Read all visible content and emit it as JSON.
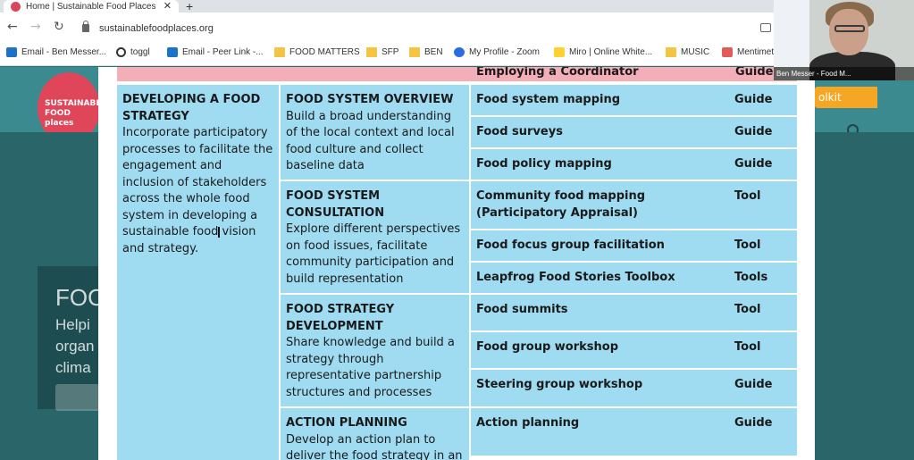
{
  "browser": {
    "tab_title": "Home | Sustainable Food Places",
    "tab_close": "✕",
    "new_tab": "+",
    "url": "sustainablefoodplaces.org",
    "nav": {
      "back": "←",
      "forward": "→",
      "reload": "↻"
    }
  },
  "bookmarks": [
    {
      "label": "Email - Ben Messer...",
      "icon": "outlook-icon"
    },
    {
      "label": "toggl",
      "icon": "toggl-icon"
    },
    {
      "label": "Email - Peer Link -...",
      "icon": "outlook-icon"
    },
    {
      "label": "FOOD MATTERS",
      "icon": "folder-icon"
    },
    {
      "label": "SFP",
      "icon": "folder-icon"
    },
    {
      "label": "BEN",
      "icon": "folder-icon"
    },
    {
      "label": "My Profile - Zoom",
      "icon": "zoom-icon"
    },
    {
      "label": "Miro | Online White...",
      "icon": "miro-icon"
    },
    {
      "label": "MUSIC",
      "icon": "folder-icon"
    },
    {
      "label": "Mentimet",
      "icon": "mentimeter-icon"
    }
  ],
  "page": {
    "logo_text": "SUSTAINABLE FOOD places",
    "toolkit_label": "olkit",
    "hero_text_1": "FOO",
    "hero_text_2": "Helpi",
    "hero_text_3": "organ",
    "hero_text_4": "clima",
    "hero_find": "Find o"
  },
  "modal": {
    "prev_row": {
      "resource": "Employing a Coordinator",
      "type": "Guide"
    },
    "category": {
      "title": "DEVELOPING A FOOD STRATEGY",
      "description": "Incorporate participatory processes to facilitate the engagement and inclusion of stakeholders across the whole food system in developing a sustainable food vision and strategy."
    },
    "themes": [
      {
        "title": "FOOD SYSTEM OVERVIEW",
        "description": "Build a broad understanding of the local context and local food culture and collect baseline data",
        "resources": [
          {
            "name": "Food system mapping",
            "type": "Guide"
          },
          {
            "name": "Food surveys",
            "type": "Guide"
          },
          {
            "name": "Food policy mapping",
            "type": "Guide"
          }
        ]
      },
      {
        "title": "FOOD SYSTEM CONSULTATION",
        "description": "Explore different perspectives on food issues, facilitate community participation and build representation",
        "resources": [
          {
            "name": "Community food mapping (Participatory Appraisal)",
            "type": "Tool"
          },
          {
            "name": "Food focus group facilitation",
            "type": "Tool"
          },
          {
            "name": "Leapfrog Food Stories Toolbox",
            "type": "Tools"
          }
        ]
      },
      {
        "title": "FOOD STRATEGY DEVELOPMENT",
        "description": "Share knowledge and build a strategy through representative partnership structures and processes",
        "resources": [
          {
            "name": "Food summits",
            "type": "Tool"
          },
          {
            "name": "Food group workshop",
            "type": "Tool"
          },
          {
            "name": "Steering group workshop",
            "type": "Guide"
          }
        ]
      },
      {
        "title": "ACTION PLANNING",
        "description": "Develop an action plan to deliver the food strategy in an",
        "resources": [
          {
            "name": "Action planning",
            "type": "Guide"
          }
        ]
      }
    ]
  },
  "webcam": {
    "label": "Ben Messer - Food M..."
  },
  "colors": {
    "row_blue": "#9fdcf2",
    "row_pink": "#f4aeb7",
    "page_teal": "#2e6e73"
  }
}
